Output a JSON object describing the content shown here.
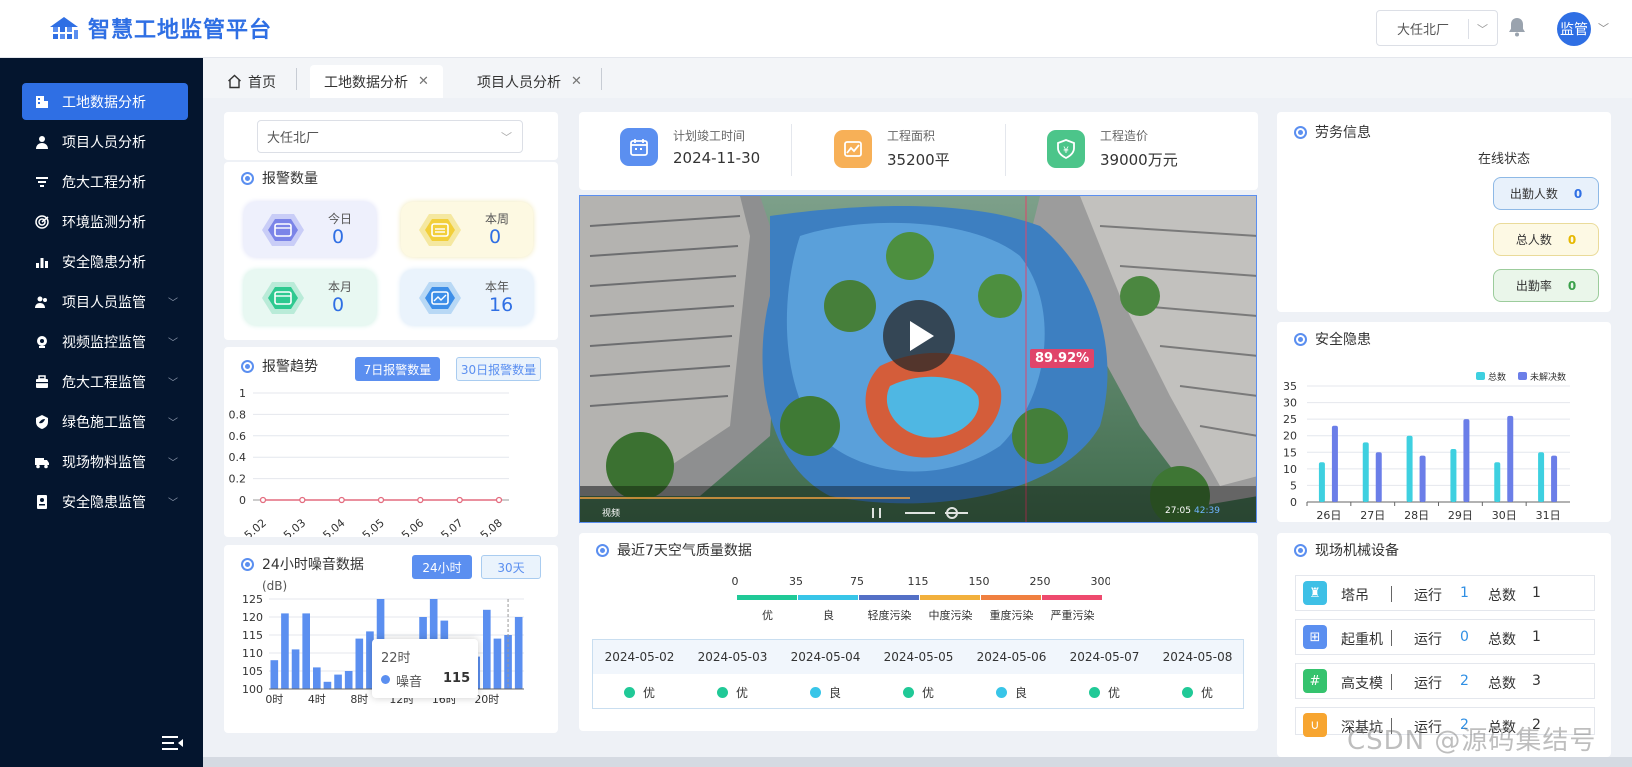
{
  "app": {
    "title": "智慧工地监管平台",
    "project_select": "大任北厂",
    "user": "监管",
    "brand_color": "#2f6fe4"
  },
  "sidebar": {
    "items": [
      {
        "label": "工地数据分析",
        "icon": "building-icon",
        "active": true,
        "expandable": false
      },
      {
        "label": "项目人员分析",
        "icon": "person-icon",
        "expandable": false
      },
      {
        "label": "危大工程分析",
        "icon": "filter-icon",
        "expandable": false
      },
      {
        "label": "环境监测分析",
        "icon": "radar-icon",
        "expandable": false
      },
      {
        "label": "安全隐患分析",
        "icon": "bar-chart-icon",
        "expandable": false
      },
      {
        "label": "项目人员监管",
        "icon": "people-icon",
        "expandable": true
      },
      {
        "label": "视频监控监管",
        "icon": "camera-icon",
        "expandable": true
      },
      {
        "label": "危大工程监管",
        "icon": "toolbox-icon",
        "expandable": true
      },
      {
        "label": "绿色施工监管",
        "icon": "shield-leaf-icon",
        "expandable": true
      },
      {
        "label": "现场物料监管",
        "icon": "truck-icon",
        "expandable": true
      },
      {
        "label": "安全隐患监管",
        "icon": "doc-icon",
        "expandable": true
      }
    ]
  },
  "tabs": [
    {
      "label": "首页",
      "closable": false
    },
    {
      "label": "工地数据分析",
      "closable": true,
      "active": true
    },
    {
      "label": "项目人员分析",
      "closable": true
    }
  ],
  "left": {
    "site_select": "大任北厂",
    "alarm_count": {
      "title": "报警数量",
      "items": [
        {
          "label": "今日",
          "value": "0"
        },
        {
          "label": "本周",
          "value": "0"
        },
        {
          "label": "本月",
          "value": "0"
        },
        {
          "label": "本年",
          "value": "16"
        }
      ]
    },
    "alarm_trend": {
      "title": "报警趋势",
      "btn_7": "7日报警数量",
      "btn_30": "30日报警数量"
    },
    "noise": {
      "title": "24小时噪音数据",
      "btn_24": "24小时",
      "btn_30": "30天",
      "unit": "(dB)",
      "legend": "噪音",
      "tooltip": {
        "time": "22时",
        "label": "噪音",
        "value": "115"
      }
    }
  },
  "stats": [
    {
      "label": "计划竣工时间",
      "value": "2024-11-30",
      "icon": "calendar-icon",
      "color": "#5b8ff0"
    },
    {
      "label": "工程面积",
      "value": "35200平",
      "icon": "area-chart-icon",
      "color": "#f7b057"
    },
    {
      "label": "工程造价",
      "value": "39000万元",
      "icon": "money-shield-icon",
      "color": "#4cc58a"
    }
  ],
  "video": {
    "badge": "89.92%",
    "label": "视频",
    "time_current": "27:05",
    "time_total": "42:39"
  },
  "aqi": {
    "title": "最近7天空气质量数据",
    "scale": [
      "0",
      "35",
      "75",
      "115",
      "150",
      "250",
      "300"
    ],
    "levels": [
      {
        "name": "优",
        "color": "#20c997"
      },
      {
        "name": "良",
        "color": "#38c5e8"
      },
      {
        "name": "轻度污染",
        "color": "#5470c6"
      },
      {
        "name": "中度污染",
        "color": "#f2b03c"
      },
      {
        "name": "重度污染",
        "color": "#f08040"
      },
      {
        "name": "严重污染",
        "color": "#ee4a6e"
      }
    ],
    "days": [
      {
        "date": "2024-05-02",
        "level": "优",
        "color": "#20c997"
      },
      {
        "date": "2024-05-03",
        "level": "优",
        "color": "#20c997"
      },
      {
        "date": "2024-05-04",
        "level": "良",
        "color": "#38c5e8"
      },
      {
        "date": "2024-05-05",
        "level": "优",
        "color": "#20c997"
      },
      {
        "date": "2024-05-06",
        "level": "良",
        "color": "#38c5e8"
      },
      {
        "date": "2024-05-07",
        "level": "优",
        "color": "#20c997"
      },
      {
        "date": "2024-05-08",
        "level": "优",
        "color": "#20c997"
      }
    ]
  },
  "labor": {
    "title": "劳务信息",
    "subtitle": "在线状态",
    "items": [
      {
        "label": "出勤人数",
        "value": "0",
        "bg": "#e8f1fb",
        "border": "#8eb9e6",
        "vcolor": "#2f6fe4"
      },
      {
        "label": "总人数",
        "value": "0",
        "bg": "#fdf9e4",
        "border": "#eadb9a",
        "vcolor": "#e6b800"
      },
      {
        "label": "出勤率",
        "value": "0",
        "bg": "#eaf6ea",
        "border": "#9ccc9c",
        "vcolor": "#3aa04a"
      }
    ]
  },
  "hazard": {
    "title": "安全隐患"
  },
  "machinery": {
    "title": "现场机械设备",
    "run_label": "运行",
    "total_label": "总数",
    "items": [
      {
        "name": "塔吊",
        "run": "1",
        "total": "1",
        "icon": "tower-crane-icon",
        "color": "#3ec0e6"
      },
      {
        "name": "起重机",
        "run": "0",
        "total": "1",
        "icon": "crane-icon",
        "color": "#5b8ff0"
      },
      {
        "name": "高支模",
        "run": "2",
        "total": "3",
        "icon": "grid-icon",
        "color": "#35c36e"
      },
      {
        "name": "深基坑",
        "run": "2",
        "total": "2",
        "icon": "pit-icon",
        "color": "#f7a530"
      }
    ]
  },
  "watermark": "CSDN @源码集结号",
  "chart_data": [
    {
      "type": "line",
      "title": "报警趋势",
      "x": [
        "5.02",
        "5.03",
        "5.04",
        "5.05",
        "5.06",
        "5.07",
        "5.08"
      ],
      "values": [
        0,
        0,
        0,
        0,
        0,
        0,
        0
      ],
      "yticks": [
        "0",
        "0.2",
        "0.4",
        "0.6",
        "0.8",
        "1"
      ],
      "ylim": [
        0,
        1
      ],
      "color": "#e36c7f"
    },
    {
      "type": "bar",
      "title": "24小时噪音数据",
      "ylabel": "(dB)",
      "legend": "噪音",
      "x": [
        "0时",
        "1时",
        "2时",
        "3时",
        "4时",
        "5时",
        "6时",
        "7时",
        "8时",
        "9时",
        "10时",
        "11时",
        "12时",
        "13时",
        "14时",
        "15时",
        "16时",
        "17时",
        "18时",
        "19时",
        "20时",
        "21时",
        "22时",
        "23时"
      ],
      "xticks": [
        "0时",
        "4时",
        "8时",
        "12时",
        "16时",
        "20时"
      ],
      "values": [
        108,
        121,
        111,
        121,
        106,
        102,
        104,
        105,
        114,
        116,
        126,
        109,
        105,
        112,
        120,
        126,
        119,
        104,
        113,
        109,
        122,
        114,
        115,
        120
      ],
      "yticks": [
        "100",
        "105",
        "110",
        "115",
        "120",
        "125"
      ],
      "ylim": [
        100,
        125
      ],
      "color": "#5b8ff0"
    },
    {
      "type": "bar",
      "title": "安全隐患",
      "categories": [
        "26日",
        "27日",
        "28日",
        "29日",
        "30日",
        "31日"
      ],
      "series": [
        {
          "name": "总数",
          "values": [
            12,
            18,
            20,
            16,
            12,
            15
          ],
          "color": "#3ed0e0"
        },
        {
          "name": "未解决数",
          "values": [
            23,
            15,
            14,
            25,
            26,
            14
          ],
          "color": "#6b7ee8"
        }
      ],
      "yticks": [
        "0",
        "5",
        "10",
        "15",
        "20",
        "25",
        "30",
        "35"
      ],
      "ylim": [
        0,
        35
      ],
      "legend": "top-right"
    }
  ]
}
